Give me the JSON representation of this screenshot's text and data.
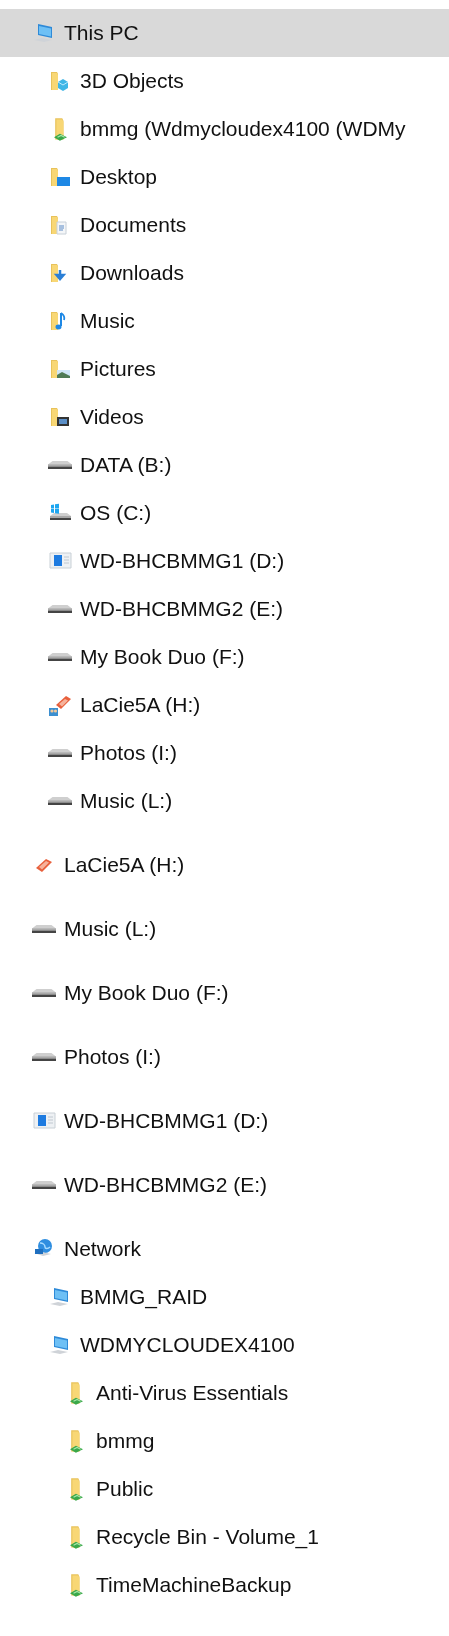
{
  "tree": [
    {
      "label": "This PC",
      "kind": "computer",
      "selected": true,
      "children": [
        {
          "label": "3D Objects",
          "kind": "objects-folder",
          "selected": false
        },
        {
          "label": "bmmg (Wdmycloudex4100 (WDMy",
          "kind": "share-folder",
          "selected": false
        },
        {
          "label": "Desktop",
          "kind": "desktop-folder",
          "selected": false
        },
        {
          "label": "Documents",
          "kind": "documents-folder",
          "selected": false
        },
        {
          "label": "Downloads",
          "kind": "downloads-folder",
          "selected": false
        },
        {
          "label": "Music",
          "kind": "music-folder",
          "selected": false
        },
        {
          "label": "Pictures",
          "kind": "pictures-folder",
          "selected": false
        },
        {
          "label": "Videos",
          "kind": "videos-folder",
          "selected": false
        },
        {
          "label": "DATA (B:)",
          "kind": "drive",
          "selected": false
        },
        {
          "label": "OS (C:)",
          "kind": "os-drive",
          "selected": false
        },
        {
          "label": "WD-BHCBMMG1 (D:)",
          "kind": "custom-drive",
          "selected": false
        },
        {
          "label": "WD-BHCBMMG2 (E:)",
          "kind": "drive",
          "selected": false
        },
        {
          "label": "My Book Duo (F:)",
          "kind": "drive",
          "selected": false
        },
        {
          "label": "LaCie5A (H:)",
          "kind": "shared-external-drive",
          "selected": false
        },
        {
          "label": "Photos (I:)",
          "kind": "drive",
          "selected": false
        },
        {
          "label": "Music (L:)",
          "kind": "drive",
          "selected": false
        }
      ]
    },
    {
      "label": "LaCie5A (H:)",
      "kind": "external-drive",
      "selected": false
    },
    {
      "label": "Music (L:)",
      "kind": "drive",
      "selected": false
    },
    {
      "label": "My Book Duo (F:)",
      "kind": "drive",
      "selected": false
    },
    {
      "label": "Photos (I:)",
      "kind": "drive",
      "selected": false
    },
    {
      "label": "WD-BHCBMMG1 (D:)",
      "kind": "custom-drive",
      "selected": false
    },
    {
      "label": "WD-BHCBMMG2 (E:)",
      "kind": "drive",
      "selected": false
    },
    {
      "label": "Network",
      "kind": "network",
      "selected": false,
      "children": [
        {
          "label": "BMMG_RAID",
          "kind": "computer",
          "selected": false
        },
        {
          "label": "WDMYCLOUDEX4100",
          "kind": "computer",
          "selected": false,
          "children": [
            {
              "label": "Anti-Virus Essentials",
              "kind": "share-folder",
              "selected": false
            },
            {
              "label": "bmmg",
              "kind": "share-folder",
              "selected": false
            },
            {
              "label": "Public",
              "kind": "share-folder",
              "selected": false
            },
            {
              "label": "Recycle Bin - Volume_1",
              "kind": "share-folder",
              "selected": false
            },
            {
              "label": "TimeMachineBackup",
              "kind": "share-folder",
              "selected": false
            }
          ]
        }
      ]
    }
  ]
}
